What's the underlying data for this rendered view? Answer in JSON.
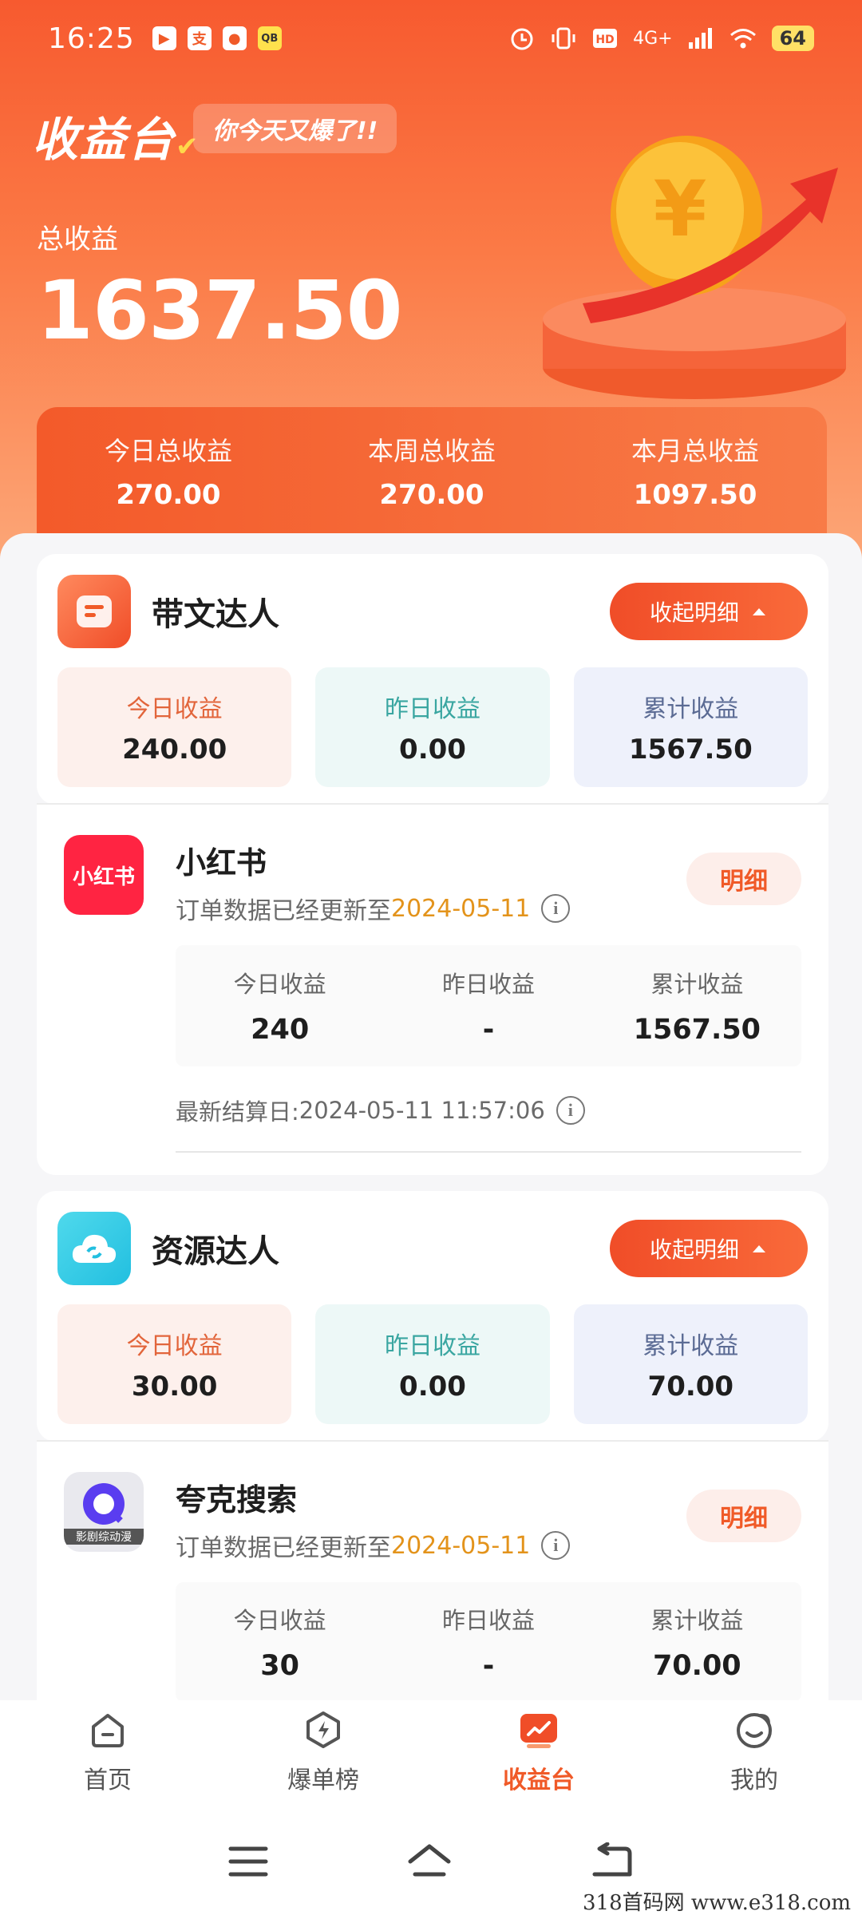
{
  "status_bar": {
    "time": "16:25",
    "app_icons": [
      "▶",
      "支",
      "●",
      "QB"
    ],
    "network": "4G+",
    "battery": "64"
  },
  "header": {
    "title": "收益台",
    "tagline": "你今天又爆了!!",
    "total_label": "总收益",
    "total_value": "1637.50"
  },
  "summary": [
    {
      "label": "今日总收益",
      "value": "270.00"
    },
    {
      "label": "本周总收益",
      "value": "270.00"
    },
    {
      "label": "本月总收益",
      "value": "1097.50"
    }
  ],
  "categories": [
    {
      "title": "带文达人",
      "collapse_label": "收起明细",
      "stats": [
        {
          "label": "今日收益",
          "value": "240.00"
        },
        {
          "label": "昨日收益",
          "value": "0.00"
        },
        {
          "label": "累计收益",
          "value": "1567.50"
        }
      ],
      "platform": {
        "logo_text": "小红书",
        "name": "小红书",
        "update_prefix": "订单数据已经更新至",
        "update_date": "2024-05-11",
        "detail_label": "明细",
        "stats": [
          {
            "label": "今日收益",
            "value": "240"
          },
          {
            "label": "昨日收益",
            "value": "-"
          },
          {
            "label": "累计收益",
            "value": "1567.50"
          }
        ],
        "settle_label": "最新结算日:",
        "settle_value": "2024-05-11 11:57:06"
      }
    },
    {
      "title": "资源达人",
      "collapse_label": "收起明细",
      "stats": [
        {
          "label": "今日收益",
          "value": "30.00"
        },
        {
          "label": "昨日收益",
          "value": "0.00"
        },
        {
          "label": "累计收益",
          "value": "70.00"
        }
      ],
      "platform": {
        "logo_text": "影剧综动漫",
        "name": "夸克搜索",
        "update_prefix": "订单数据已经更新至",
        "update_date": "2024-05-11",
        "detail_label": "明细",
        "stats": [
          {
            "label": "今日收益",
            "value": "30"
          },
          {
            "label": "昨日收益",
            "value": "-"
          },
          {
            "label": "累计收益",
            "value": "70.00"
          }
        ]
      }
    }
  ],
  "tabs": [
    {
      "label": "首页",
      "icon": "home-icon",
      "active": false
    },
    {
      "label": "爆单榜",
      "icon": "lightning-icon",
      "active": false
    },
    {
      "label": "收益台",
      "icon": "chart-icon",
      "active": true
    },
    {
      "label": "我的",
      "icon": "smiley-icon",
      "active": false
    }
  ],
  "watermark": "318首码网 www.e318.com",
  "colors": {
    "accent": "#f05a28",
    "date": "#e3931b"
  }
}
